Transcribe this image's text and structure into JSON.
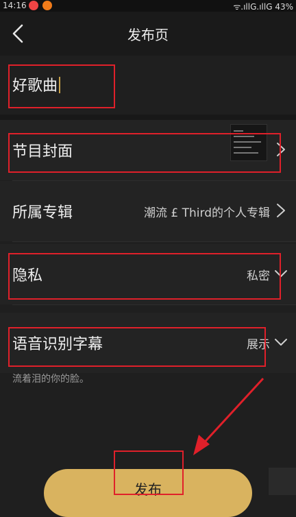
{
  "status_bar": {
    "time": "14:16",
    "signal": "ᯤ.ıllG.ıllG",
    "battery": "43%"
  },
  "header": {
    "title": "发布页",
    "back_icon": "chevron-left-icon"
  },
  "song": {
    "title": "好歌曲"
  },
  "rows": {
    "cover": {
      "label": "节目封面"
    },
    "album": {
      "label": "所属专辑",
      "value": "潮流 £ Third的个人专辑"
    },
    "privacy": {
      "label": "隐私",
      "value": "私密"
    },
    "subtitle": {
      "label": "语音识别字幕",
      "value": "展示"
    }
  },
  "lyric_hint": "流着泪的你的脸。",
  "publish_button": {
    "label": "发布"
  },
  "colors": {
    "accent": "#d9b35f",
    "annotation_red": "#e0202a",
    "background": "#1f1f1f"
  }
}
